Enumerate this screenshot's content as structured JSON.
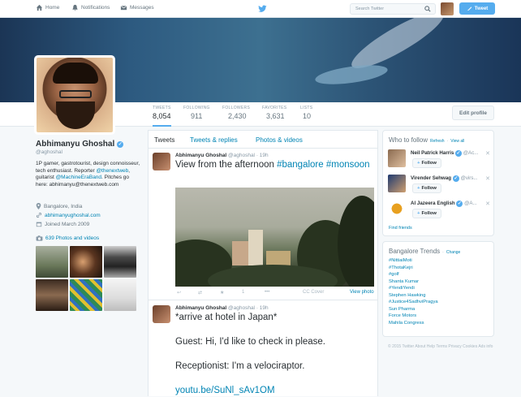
{
  "nav": {
    "home": "Home",
    "notifications": "Notifications",
    "messages": "Messages"
  },
  "search": {
    "placeholder": "Search Twitter"
  },
  "tweet_button": "Tweet",
  "stats": [
    {
      "label": "TWEETS",
      "value": "8,054"
    },
    {
      "label": "FOLLOWING",
      "value": "911"
    },
    {
      "label": "FOLLOWERS",
      "value": "2,430"
    },
    {
      "label": "FAVORITES",
      "value": "3,631"
    },
    {
      "label": "LISTS",
      "value": "10"
    }
  ],
  "edit_profile": "Edit profile",
  "profile": {
    "name": "Abhimanyu Ghoshal",
    "handle": "@aghoshal",
    "bio_1": "1P gamer, gastrotourist, design connoisseur, tech enthusiast. Reporter ",
    "bio_link1": "@thenextweb",
    "bio_2": ", guitarist ",
    "bio_link2": "@MachineEraBand",
    "bio_3": ". Pitches go here: abhimanyu@thenextweb.com",
    "location": "Bangalore, India",
    "website": "abhimanyughoshal.com",
    "joined": "Joined March 2009",
    "photos_link": "639 Photos and videos"
  },
  "tabs": [
    "Tweets",
    "Tweets & replies",
    "Photos & videos"
  ],
  "tweets": [
    {
      "name": "Abhimanyu Ghoshal",
      "handle": "@aghoshal",
      "time": "19h",
      "text_plain": "View from the afternoon ",
      "tag1": "#bangalore",
      "tag2": "#monsoon",
      "attribution": "CC Cover",
      "view_photo": "View photo",
      "retweets": "1"
    },
    {
      "name": "Abhimanyu Ghoshal",
      "handle": "@aghoshal",
      "time": "19h",
      "line1": "*arrive at hotel in Japan*",
      "line2": "Guest: Hi, I'd like to check in please.",
      "line3": "Receptionist: I'm a velociraptor.",
      "link": "youtu.be/SuNl_sAv1OM"
    }
  ],
  "who_to_follow": {
    "title": "Who to follow",
    "refresh": "Refresh",
    "view_all": "View all",
    "follow_label": "Follow",
    "find_friends": "Find friends",
    "users": [
      {
        "name": "Neil Patrick Harris",
        "handle": "@Ac..."
      },
      {
        "name": "Virender Sehwag",
        "handle": "@virs..."
      },
      {
        "name": "Al Jazeera English",
        "handle": "@A..."
      }
    ]
  },
  "trends": {
    "title": "Bangalore Trends",
    "change": "Change",
    "items": [
      "#NittiaiMoti",
      "#ThotaKejri",
      "#golf",
      "Shanta Kumar",
      "#YendiYendi",
      "Stephen Hawking",
      "#Justice4SadhviPragya",
      "Sun Pharma",
      "Force Motors",
      "Mahila Congress"
    ]
  },
  "footer": "© 2015 Twitter  About  Help  Terms  Privacy  Cookies  Ads info"
}
